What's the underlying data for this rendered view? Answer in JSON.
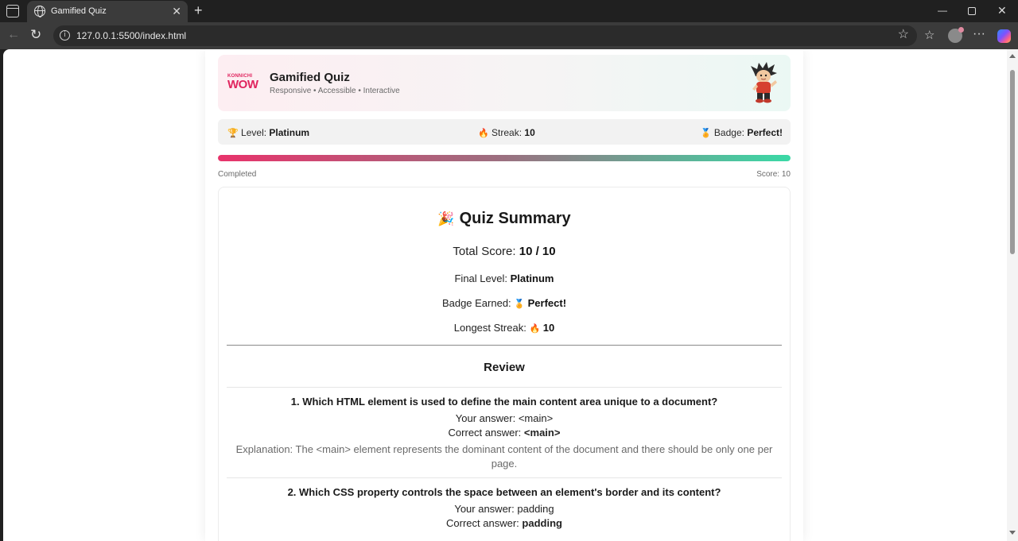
{
  "browser": {
    "tab_title": "Gamified Quiz",
    "url": "127.0.0.1:5500/index.html"
  },
  "header": {
    "logo_top": "KONNICHI",
    "logo_main": "WOW",
    "title": "Gamified Quiz",
    "subtitle": "Responsive • Accessible • Interactive"
  },
  "stats": {
    "level_icon": "trophy-icon",
    "level_label": "Level:",
    "level_value": "Platinum",
    "streak_icon": "fire-icon",
    "streak_label": "Streak:",
    "streak_value": "10",
    "badge_icon": "medal-icon",
    "badge_label": "Badge:",
    "badge_value": "Perfect!"
  },
  "progress": {
    "label": "Completed",
    "score_text": "Score: 10",
    "percent": 100
  },
  "summary": {
    "title_icon": "party-popper-icon",
    "title": "Quiz Summary",
    "total_label": "Total Score:",
    "total_value": "10 / 10",
    "level_label": "Final Level:",
    "level_value": "Platinum",
    "badge_label": "Badge Earned:",
    "badge_value": "Perfect!",
    "streak_label": "Longest Streak:",
    "streak_value": "10"
  },
  "review": {
    "title": "Review",
    "items": [
      {
        "question": "1. Which HTML element is used to define the main content area unique to a document?",
        "your_label": "Your answer:",
        "your_answer": "<main>",
        "correct_label": "Correct answer:",
        "correct_answer": "<main>",
        "explanation": "Explanation: The <main> element represents the dominant content of the document and there should be only one per page."
      },
      {
        "question": "2. Which CSS property controls the space between an element's border and its content?",
        "your_label": "Your answer:",
        "your_answer": "padding",
        "correct_label": "Correct answer:",
        "correct_answer": "padding",
        "explanation": ""
      }
    ]
  }
}
